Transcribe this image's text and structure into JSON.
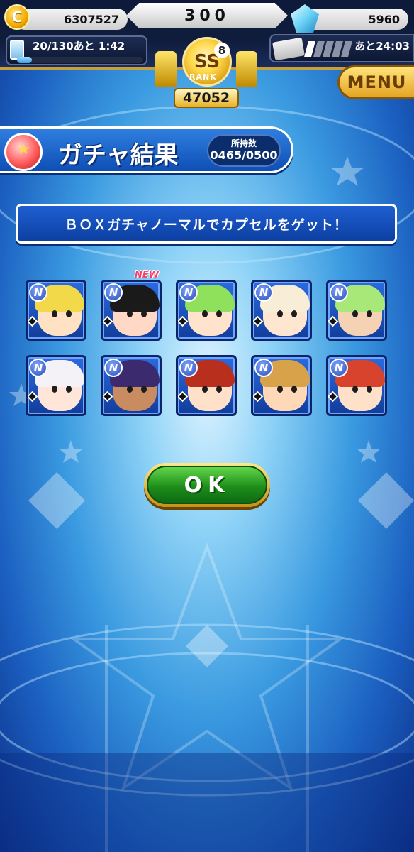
{
  "header": {
    "coin_icon_glyph": "C",
    "coins": "6307527",
    "center_value": "300",
    "gems": "5960",
    "stamina_text": "20/130あと 1:42",
    "stamina_fill_fraction": 0.12,
    "ticket_slots_filled": 1,
    "ticket_slots_total": 5,
    "ticket_timer": "あと24:03",
    "rank_grade": "SS",
    "rank_level": "8",
    "rank_label": "RANK",
    "rank_score": "47052",
    "menu_label": "MENU"
  },
  "title_bar": {
    "title": "ガチャ結果",
    "owned_label": "所持数",
    "owned_value": "0465/0500"
  },
  "banner": {
    "message": "ＢＯＸガチャノーマルでカプセルをゲット！"
  },
  "cards": [
    {
      "rarity": "N",
      "new": false,
      "hair": "#f2d94a",
      "face": "#ffe1c4"
    },
    {
      "rarity": "N",
      "new": true,
      "new_label": "NEW",
      "hair": "#1a1a1a",
      "face": "#ffd9c6"
    },
    {
      "rarity": "N",
      "new": false,
      "hair": "#8fe05a",
      "face": "#ffe3cc"
    },
    {
      "rarity": "N",
      "new": false,
      "hair": "#f8eed8",
      "face": "#ffe6d1"
    },
    {
      "rarity": "N",
      "new": false,
      "hair": "#a8e878",
      "face": "#f6d2b5"
    },
    {
      "rarity": "N",
      "new": false,
      "hair": "#f4f2f6",
      "face": "#ffe6d8"
    },
    {
      "rarity": "N",
      "new": false,
      "hair": "#3b2a6e",
      "face": "#c98b60"
    },
    {
      "rarity": "N",
      "new": false,
      "hair": "#b8301d",
      "face": "#ffe0c8"
    },
    {
      "rarity": "N",
      "new": false,
      "hair": "#d8a24a",
      "face": "#ffd8b8"
    },
    {
      "rarity": "N",
      "new": false,
      "hair": "#d8432d",
      "face": "#ffe1c9"
    }
  ],
  "ok_button": {
    "label": "OK"
  },
  "colors": {
    "accent_blue": "#1f5fd3",
    "ok_green": "#1e8e1a",
    "gold": "#e3a523"
  }
}
